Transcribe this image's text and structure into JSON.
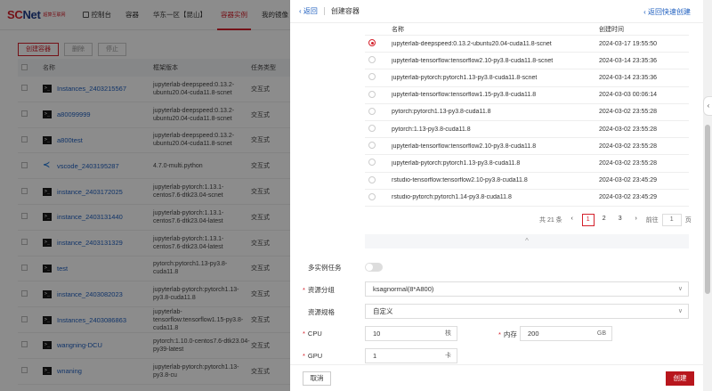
{
  "topbar": {
    "logo_main": "SC",
    "logo_net": "Net",
    "logo_sub": "超算互联网",
    "nav": [
      "控制台",
      "容器",
      "华东一区【昆山】",
      "容器实例",
      "我的镜像"
    ],
    "active_nav": 3
  },
  "background": {
    "toolbar": {
      "create": "创建容器",
      "delete": "删除",
      "stop": "停止"
    },
    "columns": {
      "name": "名称",
      "image": "框架版本",
      "type": "任务类型"
    },
    "rows": [
      {
        "icon": "terminal",
        "name": "Instances_2403215567",
        "image": "jupyterlab-deepspeed:0.13.2-ubuntu20.04-cuda11.8-scnet",
        "type": "交互式"
      },
      {
        "icon": "terminal",
        "name": "a80099999",
        "image": "jupyterlab-deepspeed:0.13.2-ubuntu20.04-cuda11.8-scnet",
        "type": "交互式"
      },
      {
        "icon": "terminal",
        "name": "a800test",
        "image": "jupyterlab-deepspeed:0.13.2-ubuntu20.04-cuda11.8-scnet",
        "type": "交互式"
      },
      {
        "icon": "vscode",
        "name": "vscode_2403195287",
        "image": "4.7.0-multi.python",
        "type": "交互式"
      },
      {
        "icon": "terminal",
        "name": "instance_2403172025",
        "image": "jupyterlab-pytorch:1.13.1-centos7.6-dtk23.04-scnet",
        "type": "交互式"
      },
      {
        "icon": "terminal",
        "name": "instance_2403131440",
        "image": "jupyterlab-pytorch:1.13.1-centos7.6-dtk23.04-latest",
        "type": "交互式"
      },
      {
        "icon": "terminal",
        "name": "instance_2403131329",
        "image": "jupyterlab-pytorch:1.13.1-centos7.6-dtk23.04-latest",
        "type": "交互式"
      },
      {
        "icon": "terminal",
        "name": "test",
        "image": "pytorch:pytorch1.13-py3.8-cuda11.8",
        "type": "交互式"
      },
      {
        "icon": "terminal",
        "name": "instance_2403082023",
        "image": "jupyterlab-pytorch:pytorch1.13-py3.8-cuda11.8",
        "type": "交互式"
      },
      {
        "icon": "terminal",
        "name": "Instances_2403086863",
        "image": "jupyterlab-tensorflow:tensorflow1.15-py3.8-cuda11.8",
        "type": "交互式"
      },
      {
        "icon": "terminal",
        "name": "wangning-DCU",
        "image": "pytorch:1.10.0-centos7.6-dtk23.04-py39-latest",
        "type": "交互式"
      },
      {
        "icon": "terminal",
        "name": "wnaning",
        "image": "jupyterlab-pytorch:pytorch1.13-py3.8-cu",
        "type": "交互式"
      }
    ]
  },
  "drawer": {
    "back": "返回",
    "title": "创建容器",
    "quick_link": "返回快速创建",
    "image_table": {
      "columns": {
        "name": "名称",
        "created": "创建时间"
      },
      "selected_index": 0,
      "rows": [
        {
          "name": "jupyterlab-deepspeed:0.13.2-ubuntu20.04-cuda11.8-scnet",
          "created": "2024-03-17 19:55:50"
        },
        {
          "name": "jupyterlab-tensorflow:tensorflow2.10-py3.8-cuda11.8-scnet",
          "created": "2024-03-14 23:35:36"
        },
        {
          "name": "jupyterlab-pytorch:pytorch1.13-py3.8-cuda11.8-scnet",
          "created": "2024-03-14 23:35:36"
        },
        {
          "name": "jupyterlab-tensorflow:tensorflow1.15-py3.8-cuda11.8",
          "created": "2024-03-03 00:06:14"
        },
        {
          "name": "pytorch:pytorch1.13-py3.8-cuda11.8",
          "created": "2024-03-02 23:55:28"
        },
        {
          "name": "pytorch:1.13-py3.8-cuda11.8",
          "created": "2024-03-02 23:55:28"
        },
        {
          "name": "jupyterlab-tensorflow:tensorflow2.10-py3.8-cuda11.8",
          "created": "2024-03-02 23:55:28"
        },
        {
          "name": "jupyterlab-pytorch:pytorch1.13-py3.8-cuda11.8",
          "created": "2024-03-02 23:55:28"
        },
        {
          "name": "rstudio-tensorflow:tensorflow2.10-py3.8-cuda11.8",
          "created": "2024-03-02 23:45:29"
        },
        {
          "name": "rstudio-pytorch:pytorch1.14-py3.8-cuda11.8",
          "created": "2024-03-02 23:45:29"
        }
      ]
    },
    "pagination": {
      "total": "共 21 条",
      "prev": "‹",
      "pages": [
        "1",
        "2",
        "3"
      ],
      "current_page": 0,
      "next": "›",
      "goto_prefix": "前往",
      "goto_value": "1",
      "goto_suffix": "页"
    },
    "collapse_icon": "chevron-up-icon",
    "form": {
      "multi_instance_label": "多实例任务",
      "multi_instance_enabled": false,
      "resource_group_label": "资源分组",
      "resource_group_value": "ksagnormal(8*A800)",
      "resource_spec_label": "资源规格",
      "resource_spec_value": "自定义",
      "cpu_label": "CPU",
      "cpu_value": "10",
      "cpu_unit": "核",
      "memory_label": "内存",
      "memory_value": "200",
      "memory_unit": "GB",
      "gpu_label": "GPU",
      "gpu_value": "1",
      "gpu_unit": "卡"
    },
    "footer": {
      "cancel": "取消",
      "create": "创建"
    }
  },
  "colors": {
    "brand": "#d4202b",
    "link": "#1f5fbf",
    "create_button": "#b8161d"
  }
}
